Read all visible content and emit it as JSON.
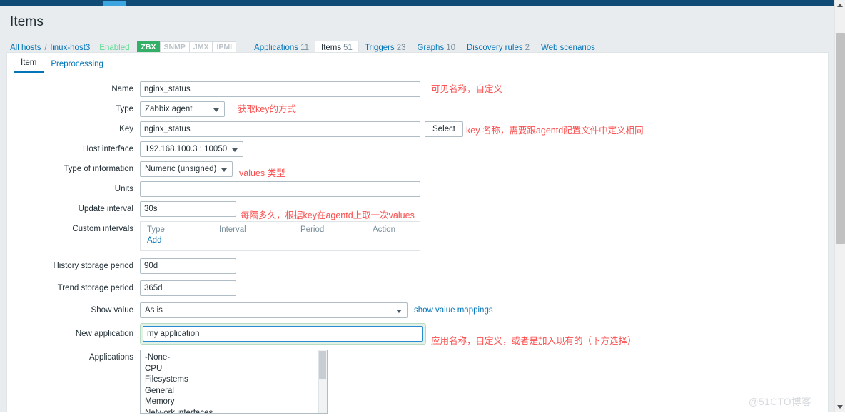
{
  "topbar": {
    "accent_color": "#3ca5e0",
    "bg_color": "#0f4b75"
  },
  "page": {
    "title": "Items"
  },
  "breadcrumb": {
    "all_hosts": "All hosts",
    "separator": "/",
    "host": "linux-host3",
    "status": "Enabled",
    "badges": [
      {
        "label": "ZBX",
        "active": true
      },
      {
        "label": "SNMP",
        "active": false
      },
      {
        "label": "JMX",
        "active": false
      },
      {
        "label": "IPMI",
        "active": false
      }
    ],
    "nav": [
      {
        "label": "Applications",
        "count": "11",
        "active": false
      },
      {
        "label": "Items",
        "count": "51",
        "active": true
      },
      {
        "label": "Triggers",
        "count": "23",
        "active": false
      },
      {
        "label": "Graphs",
        "count": "10",
        "active": false
      },
      {
        "label": "Discovery rules",
        "count": "2",
        "active": false
      },
      {
        "label": "Web scenarios",
        "count": "",
        "active": false
      }
    ]
  },
  "tabs": [
    {
      "label": "Item",
      "active": true
    },
    {
      "label": "Preprocessing",
      "active": false
    }
  ],
  "form": {
    "name": {
      "label": "Name",
      "value": "nginx_status",
      "placeholder": ""
    },
    "type": {
      "label": "Type",
      "value": "Zabbix agent"
    },
    "key": {
      "label": "Key",
      "value": "nginx_status",
      "placeholder": "",
      "select_button": "Select"
    },
    "host_interface": {
      "label": "Host interface",
      "value": "192.168.100.3 : 10050"
    },
    "type_of_information": {
      "label": "Type of information",
      "value": "Numeric (unsigned)"
    },
    "units": {
      "label": "Units",
      "value": "",
      "placeholder": ""
    },
    "update_interval": {
      "label": "Update interval",
      "value": "30s",
      "placeholder": ""
    },
    "custom_intervals": {
      "label": "Custom intervals",
      "columns": [
        "Type",
        "Interval",
        "Period",
        "Action"
      ],
      "add_link": "Add"
    },
    "history_storage_period": {
      "label": "History storage period",
      "value": "90d",
      "placeholder": ""
    },
    "trend_storage_period": {
      "label": "Trend storage period",
      "value": "365d",
      "placeholder": ""
    },
    "show_value": {
      "label": "Show value",
      "value": "As is",
      "link": "show value mappings"
    },
    "new_application": {
      "label": "New application",
      "value": "my application",
      "placeholder": "",
      "focused": true
    },
    "applications": {
      "label": "Applications",
      "options": [
        "-None-",
        "CPU",
        "Filesystems",
        "General",
        "Memory",
        "Network interfaces"
      ]
    }
  },
  "annotations": {
    "name": "可见名称，自定义",
    "type": "获取key的方式",
    "key": "key 名称，需要跟agentd配置文件中定义相同",
    "type_of_information": "values 类型",
    "update_interval": "每隔多久，根据key在agentd上取一次values",
    "new_application": "应用名称，自定义，或者是加入现有的（下方选择）",
    "color": "#fb4d4d"
  },
  "watermark": "@51CTO博客"
}
